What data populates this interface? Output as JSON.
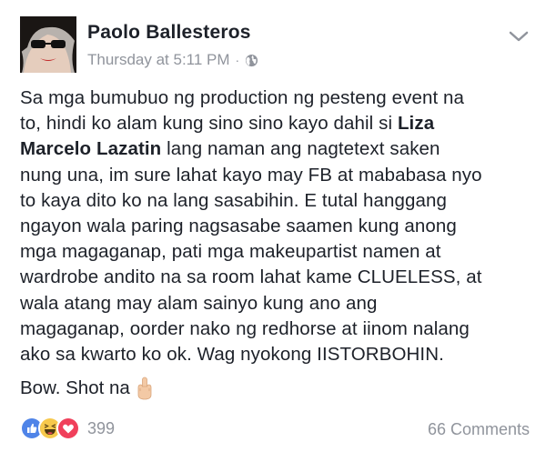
{
  "post": {
    "author": "Paolo Ballesteros",
    "timestamp": "Thursday at 5:11 PM",
    "separator": "·",
    "privacy_icon": "globe-icon",
    "options_icon": "chevron-down-icon",
    "lines": [
      [
        {
          "t": "Sa mga bumubuo ng production ng pesteng event na"
        }
      ],
      [
        {
          "t": "to, hindi ko alam kung sino sino kayo dahil si "
        },
        {
          "t": "Liza",
          "b": true
        }
      ],
      [
        {
          "t": "Marcelo Lazatin",
          "b": true
        },
        {
          "t": " lang naman ang nagtetext saken"
        }
      ],
      [
        {
          "t": "nung una, im sure lahat kayo may FB at mababasa nyo"
        }
      ],
      [
        {
          "t": "to kaya dito ko na lang sasabihin. E tutal hanggang"
        }
      ],
      [
        {
          "t": "ngayon wala paring nagsasabe saamen kung anong"
        }
      ],
      [
        {
          "t": "mga magaganap, pati mga makeupartist namen at"
        }
      ],
      [
        {
          "t": "wardrobe andito na sa room lahat kame CLUELESS, at"
        }
      ],
      [
        {
          "t": "wala atang may alam sainyo kung ano ang"
        }
      ],
      [
        {
          "t": "magaganap, oorder nako ng redhorse at iinom nalang"
        }
      ],
      [
        {
          "t": "ako sa kwarto ko ok. Wag nyokong IISTORBOHIN."
        }
      ]
    ],
    "signoff": "Bow. Shot na",
    "signoff_icon": "middle-finger-emoji-icon"
  },
  "footer": {
    "reactions": [
      "like-icon",
      "haha-icon",
      "love-icon"
    ],
    "reaction_count": "399",
    "comments": "66 Comments"
  },
  "colors": {
    "text": "#1d2129",
    "muted": "#90949c",
    "like_blue": "#4f84e8",
    "haha_yellow": "#f7c94c",
    "love_red": "#f0405b"
  }
}
